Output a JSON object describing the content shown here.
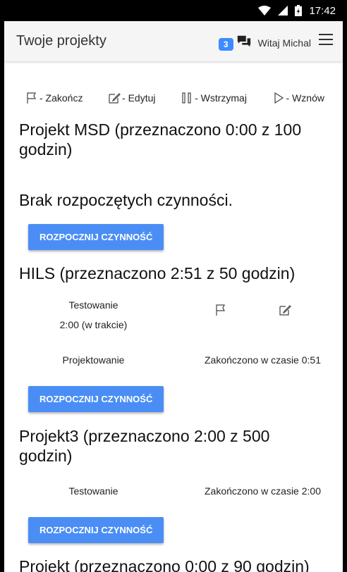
{
  "status_bar": {
    "time": "17:42"
  },
  "header": {
    "title": "Twoje projekty",
    "badge_count": "3",
    "greeting": "Witaj Michal"
  },
  "legend": {
    "finish": "- Zakończ",
    "edit": "- Edytuj",
    "pause": "- Wstrzymaj",
    "resume": "- Wznów"
  },
  "projects": [
    {
      "title": "Projekt MSD (przeznaczono 0:00 z 100 godzin)",
      "empty_message": "Brak rozpoczętych czynności.",
      "start_button": "ROZPOCZNIJ CZYNNOŚĆ"
    },
    {
      "title": "HILS (przeznaczono 2:51 z 50 godzin)",
      "activities": [
        {
          "name": "Testowanie",
          "time": "2:00 (w trakcie)"
        },
        {
          "name": "Projektowanie",
          "status": "Zakończono w czasie 0:51"
        }
      ],
      "start_button": "ROZPOCZNIJ CZYNNOŚĆ"
    },
    {
      "title": "Projekt3 (przeznaczono 2:00 z 500 godzin)",
      "activities": [
        {
          "name": "Testowanie",
          "status": "Zakończono w czasie 2:00"
        }
      ],
      "start_button": "ROZPOCZNIJ CZYNNOŚĆ"
    },
    {
      "title": "Projekt (przeznaczono 0:00 z 90 godzin)"
    }
  ]
}
